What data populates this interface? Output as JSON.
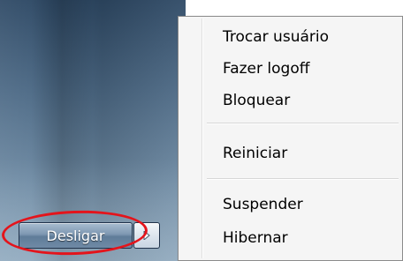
{
  "shutdown": {
    "label": "Desligar",
    "options_icon": "triangle-right-icon"
  },
  "context_menu": {
    "groups": [
      [
        "Trocar usuário",
        "Fazer logoff",
        "Bloquear"
      ],
      [
        "Reiniciar"
      ],
      [
        "Suspender",
        "Hibernar"
      ]
    ],
    "items": {
      "switch_user": "Trocar usuário",
      "log_off": "Fazer logoff",
      "lock": "Bloquear",
      "restart": "Reiniciar",
      "sleep": "Suspender",
      "hibernate": "Hibernar"
    }
  },
  "colors": {
    "annotation": "#e4141b",
    "menu_background": "#f5f5f5",
    "shutdown_text": "#ffffff"
  }
}
